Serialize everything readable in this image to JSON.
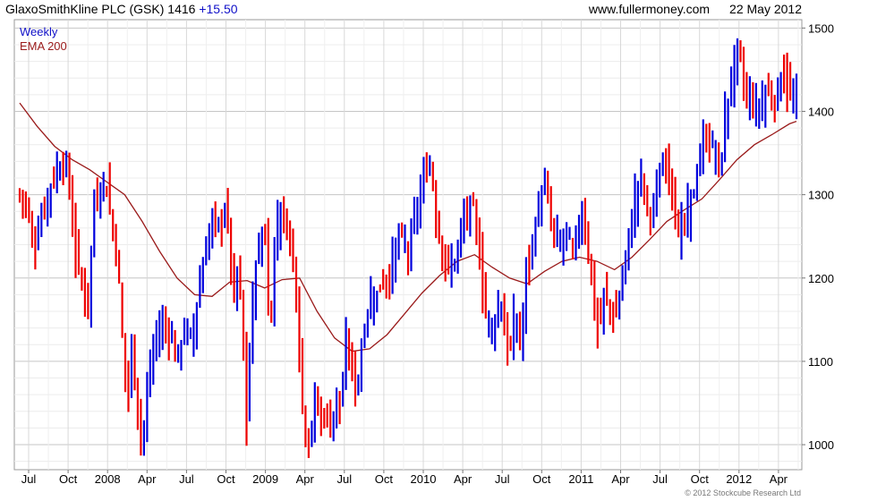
{
  "header": {
    "company": "GlaxoSmithKline PLC (GSK)",
    "price": "1416",
    "change": "+15.50",
    "site": "www.fullermoney.com",
    "date": "22 May 2012"
  },
  "footer": {
    "copyright": "© 2012 Stockcube Research Ltd"
  },
  "colors": {
    "up": "#0000dd",
    "down": "#ee0000",
    "ema": "#9a1a1a",
    "grid": "#d8d8d8",
    "legend_weekly": "#1010c8",
    "legend_ema": "#9a1a1a"
  },
  "chart_data": {
    "type": "line",
    "title": "GlaxoSmithKline PLC (GSK) 1416 +15.50",
    "xlabel": "",
    "ylabel": "",
    "ylim": [
      970,
      1510
    ],
    "y_ticks": [
      1000,
      1100,
      1200,
      1300,
      1400,
      1500
    ],
    "x_ticks": [
      "Jul",
      "Oct",
      "2008",
      "Apr",
      "Jul",
      "Oct",
      "2009",
      "Apr",
      "Jul",
      "Oct",
      "2010",
      "Apr",
      "Jul",
      "Oct",
      "2011",
      "Apr",
      "Jul",
      "Oct",
      "2012",
      "Apr"
    ],
    "grid": true,
    "legend_position": "top-left",
    "series": [
      {
        "name": "Weekly",
        "style": "high-low bars",
        "points": [
          {
            "t": 0,
            "y": 1300
          },
          {
            "t": 8,
            "y": 1290
          },
          {
            "t": 16,
            "y": 1235
          },
          {
            "t": 24,
            "y": 1270
          },
          {
            "t": 32,
            "y": 1300
          },
          {
            "t": 40,
            "y": 1325
          },
          {
            "t": 50,
            "y": 1340
          },
          {
            "t": 56,
            "y": 1320
          },
          {
            "t": 62,
            "y": 1240
          },
          {
            "t": 70,
            "y": 1200
          },
          {
            "t": 78,
            "y": 1165
          },
          {
            "t": 85,
            "y": 1290
          },
          {
            "t": 92,
            "y": 1305
          },
          {
            "t": 98,
            "y": 1320
          },
          {
            "t": 104,
            "y": 1275
          },
          {
            "t": 108,
            "y": 1250
          },
          {
            "t": 112,
            "y": 1220
          },
          {
            "t": 116,
            "y": 1150
          },
          {
            "t": 120,
            "y": 1090
          },
          {
            "t": 124,
            "y": 1060
          },
          {
            "t": 128,
            "y": 1120
          },
          {
            "t": 134,
            "y": 1050
          },
          {
            "t": 140,
            "y": 1000
          },
          {
            "t": 148,
            "y": 1085
          },
          {
            "t": 156,
            "y": 1130
          },
          {
            "t": 164,
            "y": 1145
          },
          {
            "t": 172,
            "y": 1135
          },
          {
            "t": 180,
            "y": 1100
          },
          {
            "t": 188,
            "y": 1140
          },
          {
            "t": 196,
            "y": 1125
          },
          {
            "t": 204,
            "y": 1180
          },
          {
            "t": 212,
            "y": 1230
          },
          {
            "t": 220,
            "y": 1270
          },
          {
            "t": 228,
            "y": 1260
          },
          {
            "t": 236,
            "y": 1290
          },
          {
            "t": 242,
            "y": 1210
          },
          {
            "t": 246,
            "y": 1160
          },
          {
            "t": 250,
            "y": 1230
          },
          {
            "t": 256,
            "y": 1100
          },
          {
            "t": 260,
            "y": 1010
          },
          {
            "t": 264,
            "y": 1150
          },
          {
            "t": 270,
            "y": 1220
          },
          {
            "t": 276,
            "y": 1240
          },
          {
            "t": 280,
            "y": 1270
          },
          {
            "t": 286,
            "y": 1110
          },
          {
            "t": 290,
            "y": 1230
          },
          {
            "t": 296,
            "y": 1280
          },
          {
            "t": 302,
            "y": 1270
          },
          {
            "t": 308,
            "y": 1255
          },
          {
            "t": 314,
            "y": 1215
          },
          {
            "t": 318,
            "y": 1150
          },
          {
            "t": 322,
            "y": 1060
          },
          {
            "t": 326,
            "y": 1020
          },
          {
            "t": 332,
            "y": 1000
          },
          {
            "t": 338,
            "y": 1060
          },
          {
            "t": 344,
            "y": 1030
          },
          {
            "t": 350,
            "y": 1040
          },
          {
            "t": 356,
            "y": 1020
          },
          {
            "t": 362,
            "y": 1060
          },
          {
            "t": 368,
            "y": 1040
          },
          {
            "t": 372,
            "y": 1120
          },
          {
            "t": 378,
            "y": 1110
          },
          {
            "t": 382,
            "y": 1070
          },
          {
            "t": 386,
            "y": 1070
          },
          {
            "t": 390,
            "y": 1110
          },
          {
            "t": 396,
            "y": 1150
          },
          {
            "t": 402,
            "y": 1180
          },
          {
            "t": 408,
            "y": 1175
          },
          {
            "t": 414,
            "y": 1200
          },
          {
            "t": 420,
            "y": 1195
          },
          {
            "t": 426,
            "y": 1215
          },
          {
            "t": 432,
            "y": 1250
          },
          {
            "t": 438,
            "y": 1245
          },
          {
            "t": 444,
            "y": 1230
          },
          {
            "t": 450,
            "y": 1265
          },
          {
            "t": 456,
            "y": 1290
          },
          {
            "t": 462,
            "y": 1320
          },
          {
            "t": 468,
            "y": 1340
          },
          {
            "t": 472,
            "y": 1320
          },
          {
            "t": 476,
            "y": 1270
          },
          {
            "t": 482,
            "y": 1240
          },
          {
            "t": 488,
            "y": 1210
          },
          {
            "t": 494,
            "y": 1215
          },
          {
            "t": 500,
            "y": 1230
          },
          {
            "t": 506,
            "y": 1265
          },
          {
            "t": 512,
            "y": 1280
          },
          {
            "t": 518,
            "y": 1285
          },
          {
            "t": 524,
            "y": 1245
          },
          {
            "t": 528,
            "y": 1200
          },
          {
            "t": 532,
            "y": 1160
          },
          {
            "t": 536,
            "y": 1150
          },
          {
            "t": 540,
            "y": 1140
          },
          {
            "t": 546,
            "y": 1160
          },
          {
            "t": 550,
            "y": 1175
          },
          {
            "t": 556,
            "y": 1120
          },
          {
            "t": 560,
            "y": 1105
          },
          {
            "t": 566,
            "y": 1160
          },
          {
            "t": 570,
            "y": 1130
          },
          {
            "t": 574,
            "y": 1115
          },
          {
            "t": 578,
            "y": 1210
          },
          {
            "t": 584,
            "y": 1225
          },
          {
            "t": 590,
            "y": 1270
          },
          {
            "t": 596,
            "y": 1300
          },
          {
            "t": 602,
            "y": 1310
          },
          {
            "t": 608,
            "y": 1260
          },
          {
            "t": 614,
            "y": 1245
          },
          {
            "t": 620,
            "y": 1240
          },
          {
            "t": 626,
            "y": 1260
          },
          {
            "t": 632,
            "y": 1225
          },
          {
            "t": 638,
            "y": 1260
          },
          {
            "t": 644,
            "y": 1280
          },
          {
            "t": 648,
            "y": 1250
          },
          {
            "t": 652,
            "y": 1215
          },
          {
            "t": 656,
            "y": 1170
          },
          {
            "t": 660,
            "y": 1140
          },
          {
            "t": 664,
            "y": 1150
          },
          {
            "t": 668,
            "y": 1180
          },
          {
            "t": 674,
            "y": 1170
          },
          {
            "t": 680,
            "y": 1145
          },
          {
            "t": 686,
            "y": 1180
          },
          {
            "t": 692,
            "y": 1220
          },
          {
            "t": 698,
            "y": 1260
          },
          {
            "t": 704,
            "y": 1300
          },
          {
            "t": 710,
            "y": 1325
          },
          {
            "t": 716,
            "y": 1290
          },
          {
            "t": 722,
            "y": 1275
          },
          {
            "t": 728,
            "y": 1300
          },
          {
            "t": 734,
            "y": 1330
          },
          {
            "t": 740,
            "y": 1345
          },
          {
            "t": 744,
            "y": 1320
          },
          {
            "t": 748,
            "y": 1290
          },
          {
            "t": 752,
            "y": 1245
          },
          {
            "t": 756,
            "y": 1260
          },
          {
            "t": 762,
            "y": 1270
          },
          {
            "t": 766,
            "y": 1290
          },
          {
            "t": 772,
            "y": 1310
          },
          {
            "t": 778,
            "y": 1345
          },
          {
            "t": 784,
            "y": 1370
          },
          {
            "t": 790,
            "y": 1360
          },
          {
            "t": 796,
            "y": 1350
          },
          {
            "t": 800,
            "y": 1320
          },
          {
            "t": 806,
            "y": 1390
          },
          {
            "t": 812,
            "y": 1430
          },
          {
            "t": 818,
            "y": 1460
          },
          {
            "t": 822,
            "y": 1480
          },
          {
            "t": 826,
            "y": 1440
          },
          {
            "t": 830,
            "y": 1420
          },
          {
            "t": 836,
            "y": 1415
          },
          {
            "t": 842,
            "y": 1400
          },
          {
            "t": 848,
            "y": 1410
          },
          {
            "t": 852,
            "y": 1425
          },
          {
            "t": 858,
            "y": 1420
          },
          {
            "t": 862,
            "y": 1410
          },
          {
            "t": 866,
            "y": 1420
          },
          {
            "t": 872,
            "y": 1455
          },
          {
            "t": 876,
            "y": 1430
          },
          {
            "t": 880,
            "y": 1420
          },
          {
            "t": 884,
            "y": 1410
          },
          {
            "t": 888,
            "y": 1416
          }
        ]
      },
      {
        "name": "EMA 200",
        "style": "line",
        "points": [
          {
            "t": 0,
            "y": 1410
          },
          {
            "t": 20,
            "y": 1382
          },
          {
            "t": 40,
            "y": 1358
          },
          {
            "t": 60,
            "y": 1342
          },
          {
            "t": 80,
            "y": 1330
          },
          {
            "t": 100,
            "y": 1315
          },
          {
            "t": 120,
            "y": 1300
          },
          {
            "t": 140,
            "y": 1268
          },
          {
            "t": 160,
            "y": 1232
          },
          {
            "t": 180,
            "y": 1200
          },
          {
            "t": 200,
            "y": 1180
          },
          {
            "t": 220,
            "y": 1178
          },
          {
            "t": 240,
            "y": 1195
          },
          {
            "t": 260,
            "y": 1197
          },
          {
            "t": 280,
            "y": 1188
          },
          {
            "t": 300,
            "y": 1198
          },
          {
            "t": 320,
            "y": 1200
          },
          {
            "t": 340,
            "y": 1160
          },
          {
            "t": 360,
            "y": 1128
          },
          {
            "t": 380,
            "y": 1112
          },
          {
            "t": 400,
            "y": 1115
          },
          {
            "t": 420,
            "y": 1132
          },
          {
            "t": 440,
            "y": 1157
          },
          {
            "t": 460,
            "y": 1182
          },
          {
            "t": 480,
            "y": 1203
          },
          {
            "t": 500,
            "y": 1220
          },
          {
            "t": 520,
            "y": 1228
          },
          {
            "t": 540,
            "y": 1213
          },
          {
            "t": 560,
            "y": 1200
          },
          {
            "t": 580,
            "y": 1193
          },
          {
            "t": 600,
            "y": 1208
          },
          {
            "t": 620,
            "y": 1220
          },
          {
            "t": 640,
            "y": 1225
          },
          {
            "t": 660,
            "y": 1220
          },
          {
            "t": 680,
            "y": 1210
          },
          {
            "t": 700,
            "y": 1225
          },
          {
            "t": 720,
            "y": 1246
          },
          {
            "t": 740,
            "y": 1268
          },
          {
            "t": 760,
            "y": 1282
          },
          {
            "t": 780,
            "y": 1295
          },
          {
            "t": 800,
            "y": 1318
          },
          {
            "t": 820,
            "y": 1342
          },
          {
            "t": 840,
            "y": 1360
          },
          {
            "t": 860,
            "y": 1372
          },
          {
            "t": 880,
            "y": 1385
          },
          {
            "t": 888,
            "y": 1388
          }
        ]
      }
    ]
  }
}
